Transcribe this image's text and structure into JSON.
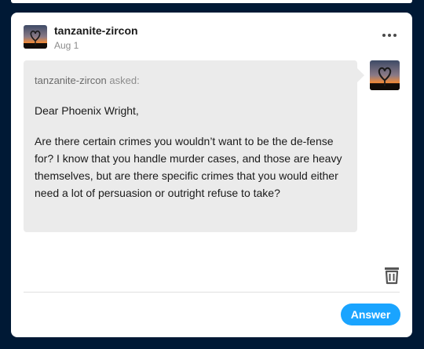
{
  "post": {
    "username": "tanzanite-zircon",
    "date": "Aug 1",
    "more_icon": "ellipsis-icon"
  },
  "ask": {
    "asker": "tanzanite-zircon",
    "asked_label": "asked:",
    "greeting": "Dear Phoenix Wright,",
    "question": "Are there certain crimes you wouldn’t want to be the de-fense for? I know that you handle murder cases, and those are heavy themselves, but are there specific crimes that you would either need a lot of persuasion or outright refuse to take?"
  },
  "actions": {
    "delete_icon": "trash-icon",
    "answer_label": "Answer"
  },
  "colors": {
    "background": "#001935",
    "card": "#ffffff",
    "bubble": "#ebebeb",
    "accent": "#1aa4ff"
  }
}
